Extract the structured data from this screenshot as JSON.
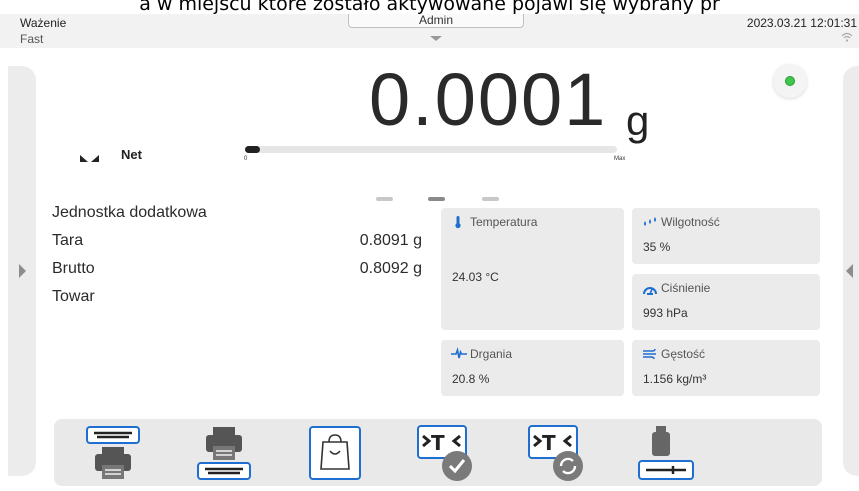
{
  "caption": "a w miejscu które zostało aktywowane pojawi się wybrany pr",
  "header": {
    "mode_title": "Ważenie",
    "mode_sub": "Fast",
    "user": "Admin",
    "datetime": "2023.03.21 12:01:31",
    "wifi_icon": "wifi-icon"
  },
  "reading": {
    "value": "0.0001",
    "unit": "g",
    "label": "Net",
    "stable": true,
    "status_color": "#3cc84a",
    "bargraph": {
      "min_label": "0",
      "max_label": "Max",
      "fill_fraction": 0.04
    }
  },
  "pages": {
    "count": 3,
    "active": 2
  },
  "info_rows": [
    {
      "label": "Jednostka dodatkowa",
      "value": ""
    },
    {
      "label": "Tara",
      "value": "0.8091 g"
    },
    {
      "label": "Brutto",
      "value": "0.8092 g"
    },
    {
      "label": "Towar",
      "value": ""
    }
  ],
  "tiles": {
    "temperature": {
      "title": "Temperatura",
      "value": "24.03 °C",
      "icon": "thermometer-icon"
    },
    "humidity": {
      "title": "Wilgotność",
      "value": "35 %",
      "icon": "droplets-icon"
    },
    "pressure": {
      "title": "Ciśnienie",
      "value": "993 hPa",
      "icon": "gauge-icon"
    },
    "vibration": {
      "title": "Drgania",
      "value": "20.8 %",
      "icon": "vibration-icon"
    },
    "density": {
      "title": "Gęstość",
      "value": "1.156 kg/m³",
      "icon": "wind-icon"
    }
  },
  "toolbar": [
    {
      "icon": "printer-header-icon"
    },
    {
      "icon": "printer-footer-icon"
    },
    {
      "icon": "product-bag-icon"
    },
    {
      "icon": "tare-confirm-icon"
    },
    {
      "icon": "tare-reset-icon"
    },
    {
      "icon": "weight-adjust-icon"
    }
  ],
  "colors": {
    "accent": "#1f6fd1",
    "tile_bg": "#ebebeb",
    "toolbar_bg": "#e9e9e9"
  }
}
